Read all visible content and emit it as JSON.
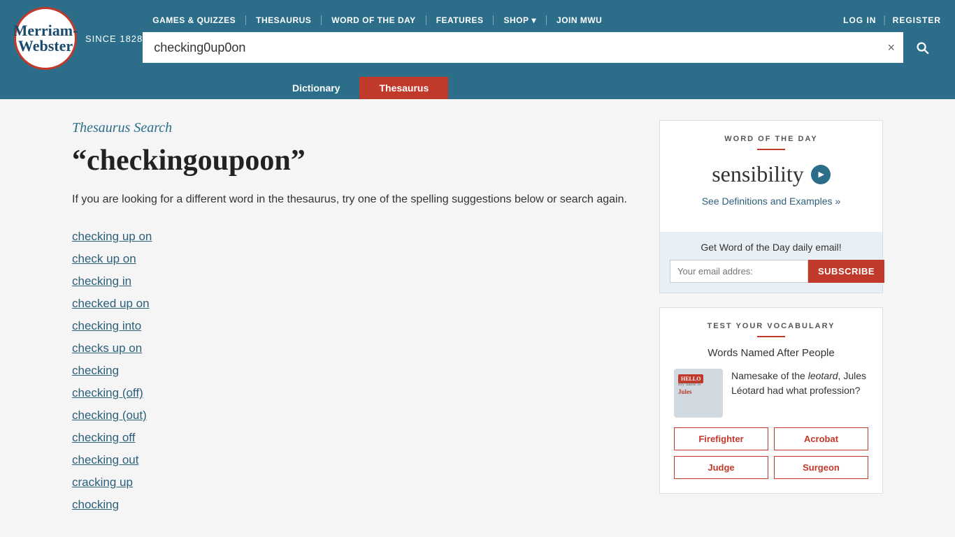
{
  "header": {
    "logo": {
      "text_line1": "Merriam-",
      "text_line2": "Webster",
      "since": "SINCE 1828"
    },
    "nav": {
      "items": [
        {
          "label": "GAMES & QUIZZES"
        },
        {
          "label": "THESAURUS"
        },
        {
          "label": "WORD OF THE DAY"
        },
        {
          "label": "FEATURES"
        },
        {
          "label": "SHOP"
        },
        {
          "label": "JOIN MWU"
        }
      ],
      "auth": [
        {
          "label": "LOG IN"
        },
        {
          "label": "REGISTER"
        }
      ]
    },
    "search": {
      "value": "checking0up0on",
      "clear_label": "×",
      "button_label": "Search"
    },
    "tabs": [
      {
        "label": "Dictionary",
        "active": false
      },
      {
        "label": "Thesaurus",
        "active": true
      }
    ]
  },
  "content": {
    "section_label": "Thesaurus Search",
    "search_term": "“checkingoupoon”",
    "suggestion_text": "If you are looking for a different word in the thesaurus, try one of the spelling suggestions below or search again.",
    "suggestions": [
      "checking up on",
      "check up on",
      "checking in",
      "checked up on",
      "checking into",
      "checks up on",
      "checking",
      "checking (off)",
      "checking (out)",
      "checking off",
      "checking out",
      "cracking up",
      "chocking"
    ]
  },
  "sidebar": {
    "wotd": {
      "label": "WORD OF THE DAY",
      "word": "sensibility",
      "link_text": "See Definitions and Examples",
      "link_suffix": "»",
      "email_label": "Get Word of the Day daily email!",
      "email_placeholder": "Your email addres:",
      "subscribe_label": "SUBSCRIBE"
    },
    "vocab": {
      "label": "TEST YOUR VOCABULARY",
      "title": "Words Named After People",
      "question": "Namesake of the leotard, Jules Léotard had what profession?",
      "choices": [
        "Firefighter",
        "Acrobat",
        "Judge",
        "Surgeon"
      ]
    }
  }
}
